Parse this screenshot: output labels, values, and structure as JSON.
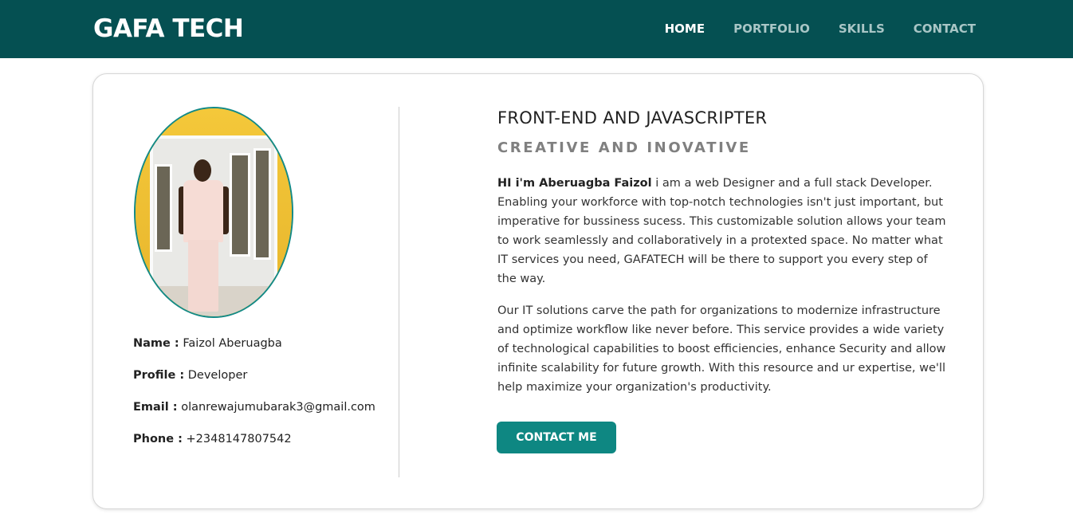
{
  "header": {
    "brand": "GAFA TECH",
    "nav": [
      {
        "label": "HOME",
        "active": true
      },
      {
        "label": "PORTFOLIO",
        "active": false
      },
      {
        "label": "SKILLS",
        "active": false
      },
      {
        "label": "CONTACT",
        "active": false
      }
    ],
    "bg_color": "#055052"
  },
  "profile": {
    "name_label": "Name :",
    "name_value": "Faizol Aberuagba",
    "profile_label": "Profile :",
    "profile_value": "Developer",
    "email_label": "Email :",
    "email_value": "olanrewajumubarak3@gmail.com",
    "phone_label": "Phone :",
    "phone_value": "+2348147807542"
  },
  "content": {
    "headline": "FRONT-END AND JAVASCRIPTER",
    "subheadline": "CREATIVE AND INOVATIVE",
    "intro_bold": "HI i'm Aberuagba Faizol",
    "intro_rest": " i am a web Designer and a full stack Developer. Enabling your workforce with top-notch technologies isn't just important, but imperative for bussiness sucess. This customizable solution allows your team to work seamlessly and collaboratively in a protexted space. No matter what IT services you need, GAFATECH will be there to support you every step of the way.",
    "paragraph2": "Our IT solutions carve the path for organizations to modernize infrastructure and optimize workflow like never before. This service provides a wide variety of technological capabilities to boost efficiencies, enhance Security and allow infinite scalability for future growth. With this resource and ur expertise, we'll help maximize your organization's productivity.",
    "cta_label": "CONTACT ME",
    "accent_color": "#0e8782"
  }
}
